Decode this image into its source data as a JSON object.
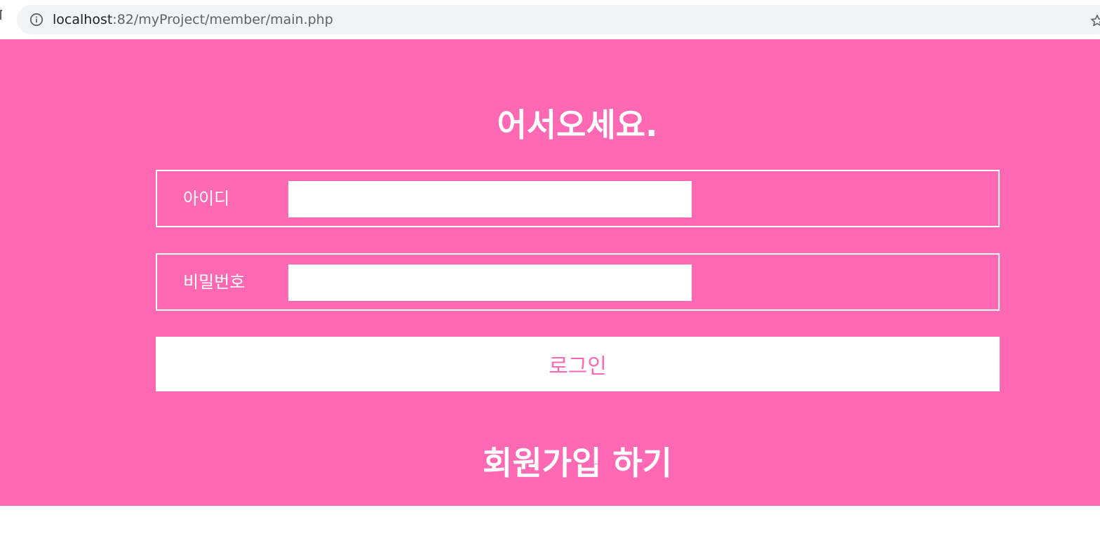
{
  "browser": {
    "url_host": "localhost",
    "url_rest": ":82/myProject/member/main.php"
  },
  "page": {
    "title": "어서오세요.",
    "id_label": "아이디",
    "id_value": "",
    "password_label": "비밀번호",
    "password_value": "",
    "login_label": "로그인",
    "signup_label": "회원가입 하기"
  },
  "colors": {
    "background": "#ff69b4",
    "foreground": "#ffffff",
    "omnibox": "#f1f3f4"
  },
  "icons": {
    "site_info": "info-icon",
    "bookmark": "star-icon"
  }
}
